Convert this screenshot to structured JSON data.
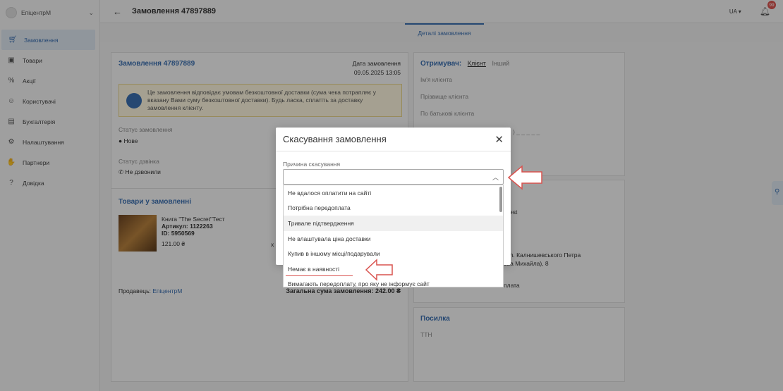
{
  "brand": {
    "name": "ЕпіцентрМ"
  },
  "sidebar": {
    "items": [
      {
        "label": "Замовлення",
        "icon": "cart-icon",
        "active": true
      },
      {
        "label": "Товари",
        "icon": "store-icon"
      },
      {
        "label": "Акції",
        "icon": "discount-icon"
      },
      {
        "label": "Користувачі",
        "icon": "users-icon"
      },
      {
        "label": "Бухгалтерія",
        "icon": "wallet-icon"
      },
      {
        "label": "Налаштування",
        "icon": "gear-icon"
      },
      {
        "label": "Партнери",
        "icon": "handshake-icon"
      },
      {
        "label": "Довідка",
        "icon": "help-icon"
      }
    ]
  },
  "header": {
    "title": "Замовлення 47897889",
    "lang": "UA",
    "notifications": "99"
  },
  "tabs": {
    "active": "Деталі замовлення"
  },
  "order": {
    "title": "Замовлення 47897889",
    "date_label": "Дата замовлення",
    "date": "09.05.2025 13:05",
    "notice": "Це замовлення відповідає умовам безкоштовної доставки (сума чека потрапляє у вказану Вами суму безкоштовної доставки). Будь ласка, сплатіть за доставку замовлення клієнту.",
    "status_label": "Статус замовлення",
    "status": "Нове",
    "call_label": "Статус дзвінка",
    "call": "Не дзвонили",
    "goods_title": "Товари у замовленні",
    "item_name": "Книга \"The Secret\"Тест",
    "item_sku": "Артикул: 1122263",
    "item_id": "ID: 5950569",
    "item_price": "121.00 ₴",
    "item_mult": "x",
    "seller_label": "Продавець:",
    "seller": "ЕпіцентрМ",
    "total": "Загальна сума замовлення: 242.00 ₴"
  },
  "recipient": {
    "title": "Отримувач:",
    "client": "Клієнт",
    "other": "Інший",
    "first_name": "Ім'я клієнта",
    "last_name": "Прізвище клієнта",
    "patronymic": "По батькові клієнта",
    "phone_mask": ") _ _ _ _ _",
    "partial_1": "est",
    "addr_1": "вул. Калнишевського Петра",
    "addr_2": "ова Михайла), 8",
    "pay": "плата",
    "parcel_title": "Посилка",
    "ttn": "ТТН"
  },
  "modal": {
    "title": "Скасування замовлення",
    "field_label": "Причина скасування",
    "options": [
      "Не вдалося оплатити на сайті",
      "Потрібна передоплата",
      "Тривале підтвердження",
      "Не влаштувала ціна доставки",
      "Купив в іншому місці/подарували",
      "Немає в наявності",
      "Вимагають передоплату, про яку не інформує сайт"
    ],
    "highlighted_index": 2
  }
}
